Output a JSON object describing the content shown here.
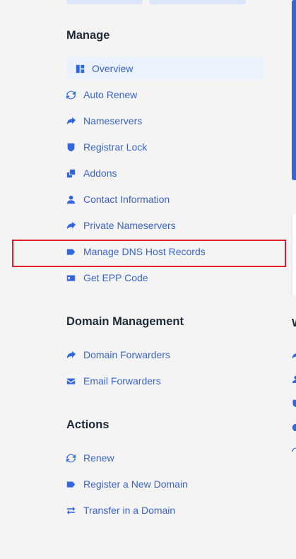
{
  "sections": {
    "manage": {
      "title": "Manage",
      "items": [
        {
          "label": "Overview",
          "icon": "overview-icon"
        },
        {
          "label": "Auto Renew",
          "icon": "sync-icon"
        },
        {
          "label": "Nameservers",
          "icon": "share-arrow-icon"
        },
        {
          "label": "Registrar Lock",
          "icon": "shield-icon"
        },
        {
          "label": "Addons",
          "icon": "clone-icon"
        },
        {
          "label": "Contact Information",
          "icon": "user-icon"
        },
        {
          "label": "Private Nameservers",
          "icon": "share-arrow-icon"
        },
        {
          "label": "Manage DNS Host Records",
          "icon": "tag-icon"
        },
        {
          "label": "Get EPP Code",
          "icon": "id-card-icon"
        }
      ]
    },
    "domain_management": {
      "title": "Domain Management",
      "items": [
        {
          "label": "Domain Forwarders",
          "icon": "share-square-icon"
        },
        {
          "label": "Email Forwarders",
          "icon": "envelope-icon"
        }
      ]
    },
    "actions": {
      "title": "Actions",
      "items": [
        {
          "label": "Renew",
          "icon": "sync-icon"
        },
        {
          "label": "Register a New Domain",
          "icon": "tag-icon"
        },
        {
          "label": "Transfer in a Domain",
          "icon": "exchange-icon"
        }
      ]
    }
  },
  "right_panel": {
    "letter": "W"
  },
  "colors": {
    "accent": "#3367e0",
    "link": "#3a63c9",
    "active_bg": "#ebf1fd",
    "highlight": "#e11d2a",
    "background": "#f4f4f5"
  }
}
